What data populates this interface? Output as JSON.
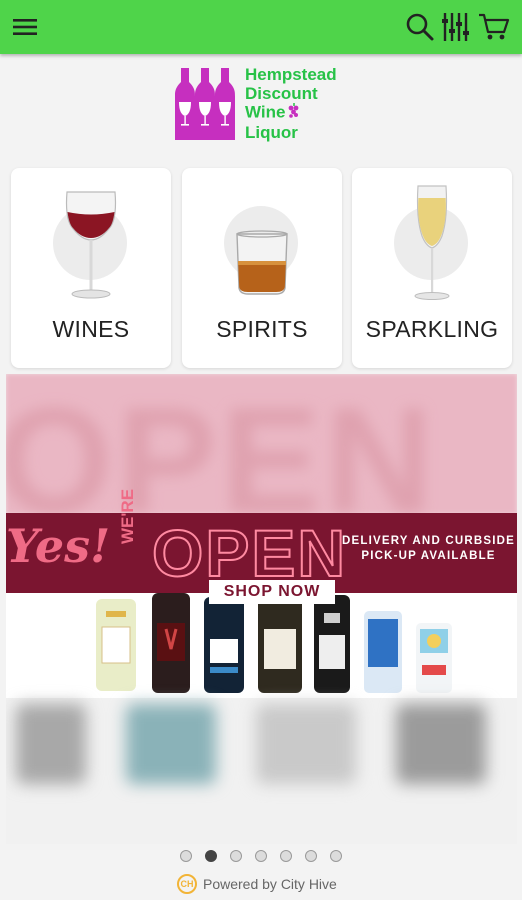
{
  "header": {
    "menu_icon": "hamburger-menu-icon",
    "search_icon": "search-icon",
    "filter_icon": "filter-icon",
    "cart_icon": "cart-icon",
    "background_color": "#4fd44a"
  },
  "logo": {
    "lines": [
      "Hempstead",
      "Discount",
      "Wine",
      "Liquor"
    ],
    "text_color": "#27c247",
    "bottle_color": "#c62fbf"
  },
  "categories": [
    {
      "label": "WINES",
      "icon": "red-wine-glass-icon"
    },
    {
      "label": "SPIRITS",
      "icon": "whiskey-glass-icon"
    },
    {
      "label": "SPARKLING",
      "icon": "champagne-flute-icon"
    }
  ],
  "banner": {
    "yes_text": "Yes!",
    "were_text": "WE'RE",
    "open_text": "OPEN",
    "delivery_text": "DELIVERY AND CURBSIDE PICK-UP AVAILABLE",
    "cta_label": "SHOP NOW",
    "accent_color": "#7b1530"
  },
  "carousel": {
    "total_slides": 7,
    "active_index": 1
  },
  "footer": {
    "powered_text": "Powered by City Hive",
    "logo_text": "CH"
  }
}
